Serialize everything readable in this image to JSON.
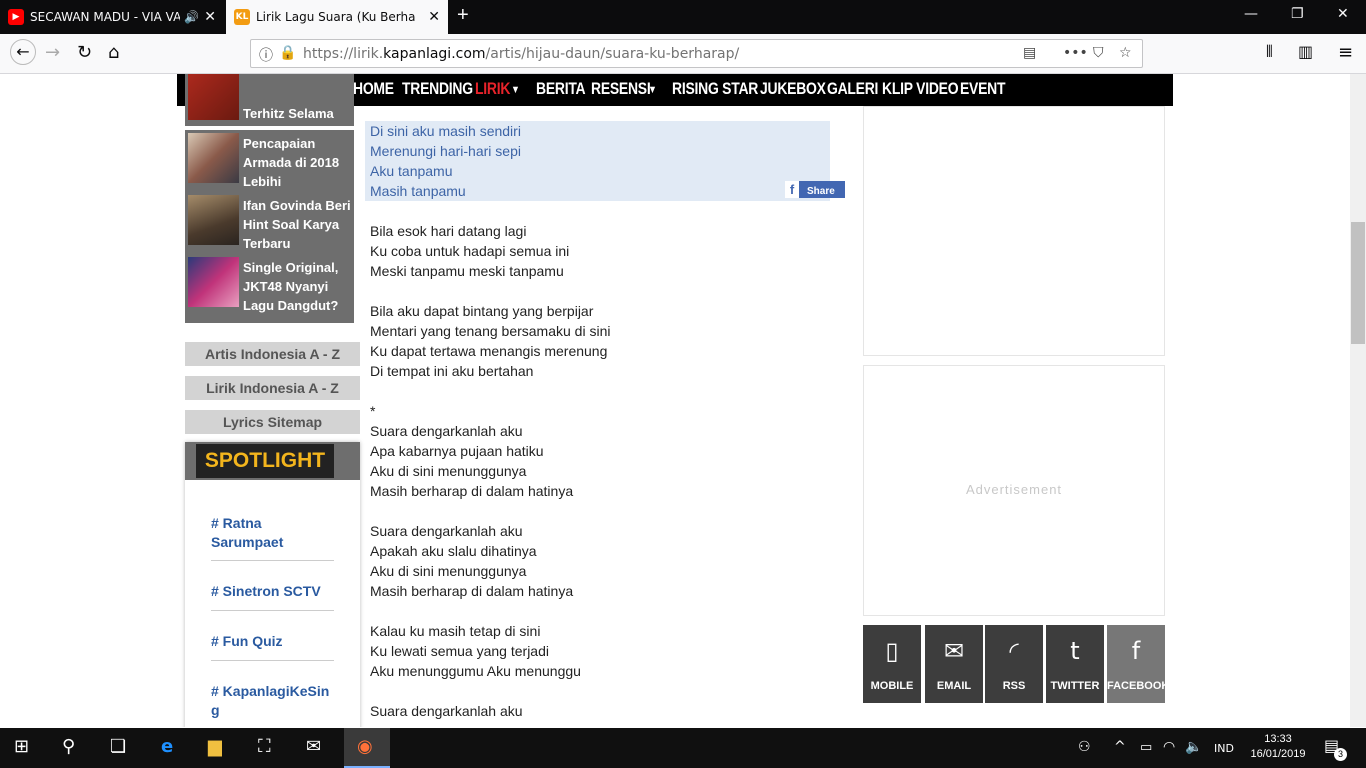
{
  "browser": {
    "tabs": [
      {
        "title": "SECAWAN MADU - VIA VALL",
        "favicon": "youtube-icon",
        "active": false
      },
      {
        "title": "Lirik Lagu Suara (Ku Berharap) -",
        "favicon": "kapanlagi-icon",
        "active": true
      }
    ],
    "url_prefix": "https://lirik.",
    "url_domain": "kapanlagi.com",
    "url_path": "/artis/hijau-daun/suara-ku-berharap/"
  },
  "site": {
    "menu": [
      "HOME",
      "TRENDING",
      "LIRIK",
      "BERITA",
      "RESENSI",
      "RISING STAR",
      "JUKEBOX",
      "GALERI",
      "KLIP VIDEO",
      "EVENT"
    ],
    "active_menu": "LIRIK",
    "accent_color": "#e8232a",
    "news": [
      {
        "title": "Terhitz Selama"
      },
      {
        "title": "Pencapaian Armada di 2018 Lebihi"
      },
      {
        "title": "Ifan Govinda Beri Hint Soal Karya Terbaru"
      },
      {
        "title": "Single Original, JKT48 Nyanyi Lagu Dangdut?"
      }
    ],
    "side_buttons": [
      "Artis Indonesia A - Z",
      "Lirik Indonesia A - Z",
      "Lyrics Sitemap"
    ],
    "spotlight": {
      "title": "SPOTLIGHT",
      "links": [
        "# Ratna Sarumpaet",
        "# Sinetron SCTV",
        "# Fun Quiz",
        "# KapanlagiKeSing"
      ]
    },
    "lyrics_highlight": [
      "Di sini aku masih sendiri",
      "Merenungi hari-hari sepi",
      "Aku tanpamu",
      "Masih tanpamu"
    ],
    "share_label": "Share",
    "lyrics": [
      "Bila esok hari datang lagi",
      "Ku coba untuk hadapi semua ini",
      "Meski tanpamu meski tanpamu",
      "",
      "Bila aku dapat bintang yang berpijar",
      "Mentari yang tenang bersamaku di sini",
      "Ku dapat tertawa menangis merenung",
      "Di tempat ini aku bertahan",
      "",
      "*",
      "Suara dengarkanlah aku",
      "Apa kabarnya pujaan hatiku",
      "Aku di sini menunggunya",
      "Masih berharap di dalam hatinya",
      "",
      "Suara dengarkanlah aku",
      "Apakah aku slalu dihatinya",
      "Aku di sini menunggunya",
      "Masih berharap di dalam hatinya",
      "",
      "Kalau ku masih tetap di sini",
      "Ku lewati semua yang terjadi",
      "Aku menunggumu Aku menunggu",
      "",
      "Suara dengarkanlah aku"
    ],
    "ad_label": "Advertisement",
    "social": [
      {
        "label": "MOBILE",
        "icon": "mobile-icon"
      },
      {
        "label": "EMAIL",
        "icon": "email-icon"
      },
      {
        "label": "RSS",
        "icon": "rss-icon"
      },
      {
        "label": "TWITTER",
        "icon": "twitter-icon"
      },
      {
        "label": "FACEBOOK",
        "icon": "facebook-icon"
      }
    ]
  },
  "taskbar": {
    "language": "IND",
    "time": "13:33",
    "date": "16/01/2019",
    "notifications": "3"
  }
}
